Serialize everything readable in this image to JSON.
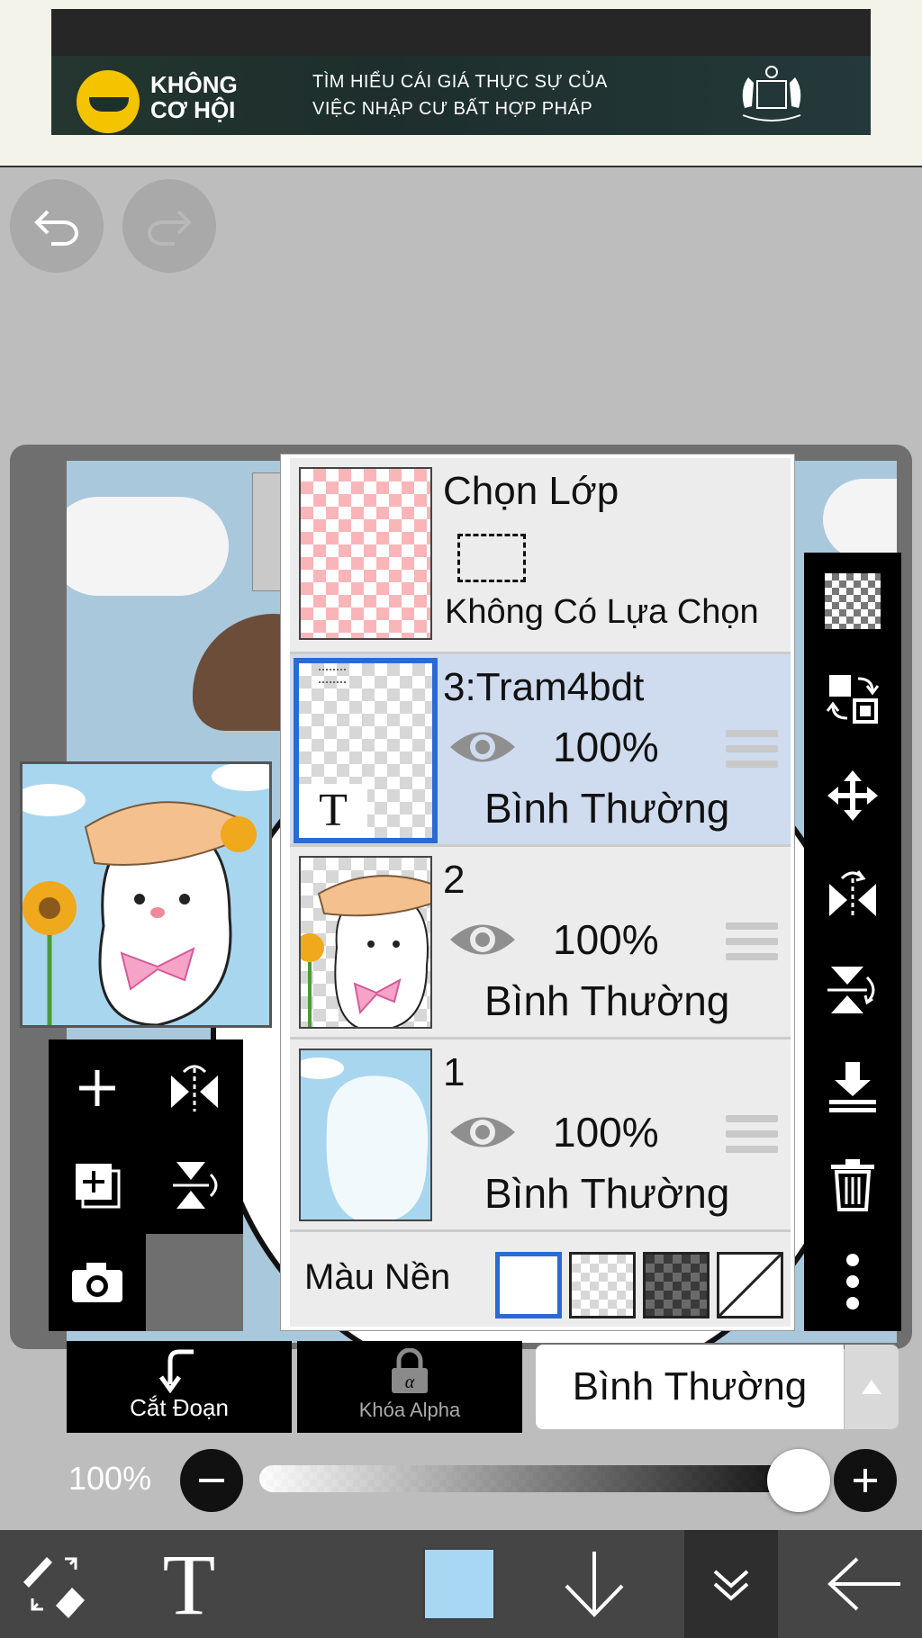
{
  "ad": {
    "brand": "KHÔNG CƠ HỘI",
    "text_line1": "TÌM HIỂU CÁI GIÁ THỰC SỰ CỦA",
    "text_line2": "VIỆC NHẬP CƯ BẤT HỢP PHÁP"
  },
  "layers_panel": {
    "selection": {
      "title": "Chọn Lớp",
      "status": "Không Có Lựa Chọn"
    },
    "layers": [
      {
        "name": "3:Tram4bdt",
        "opacity": "100%",
        "blend": "Bình Thường",
        "selected": true,
        "text_badge": "T"
      },
      {
        "name": "2",
        "opacity": "100%",
        "blend": "Bình Thường",
        "selected": false
      },
      {
        "name": "1",
        "opacity": "100%",
        "blend": "Bình Thường",
        "selected": false
      }
    ],
    "background": {
      "label": "Màu Nền",
      "selected_index": 0
    }
  },
  "controls": {
    "clipping_label": "Cắt Đoạn",
    "alpha_lock_label": "Khóa Alpha",
    "blend_mode": "Bình Thường",
    "opacity_label": "100%",
    "opacity_value": 1.0
  },
  "bottom_bar": {
    "current_color": "#a8d7f3",
    "text_tool_glyph": "T"
  },
  "colors": {
    "accent": "#2a6ad6",
    "selected_row": "#cfdbee",
    "toolbar": "#000000",
    "bottom_bar": "#454545"
  }
}
